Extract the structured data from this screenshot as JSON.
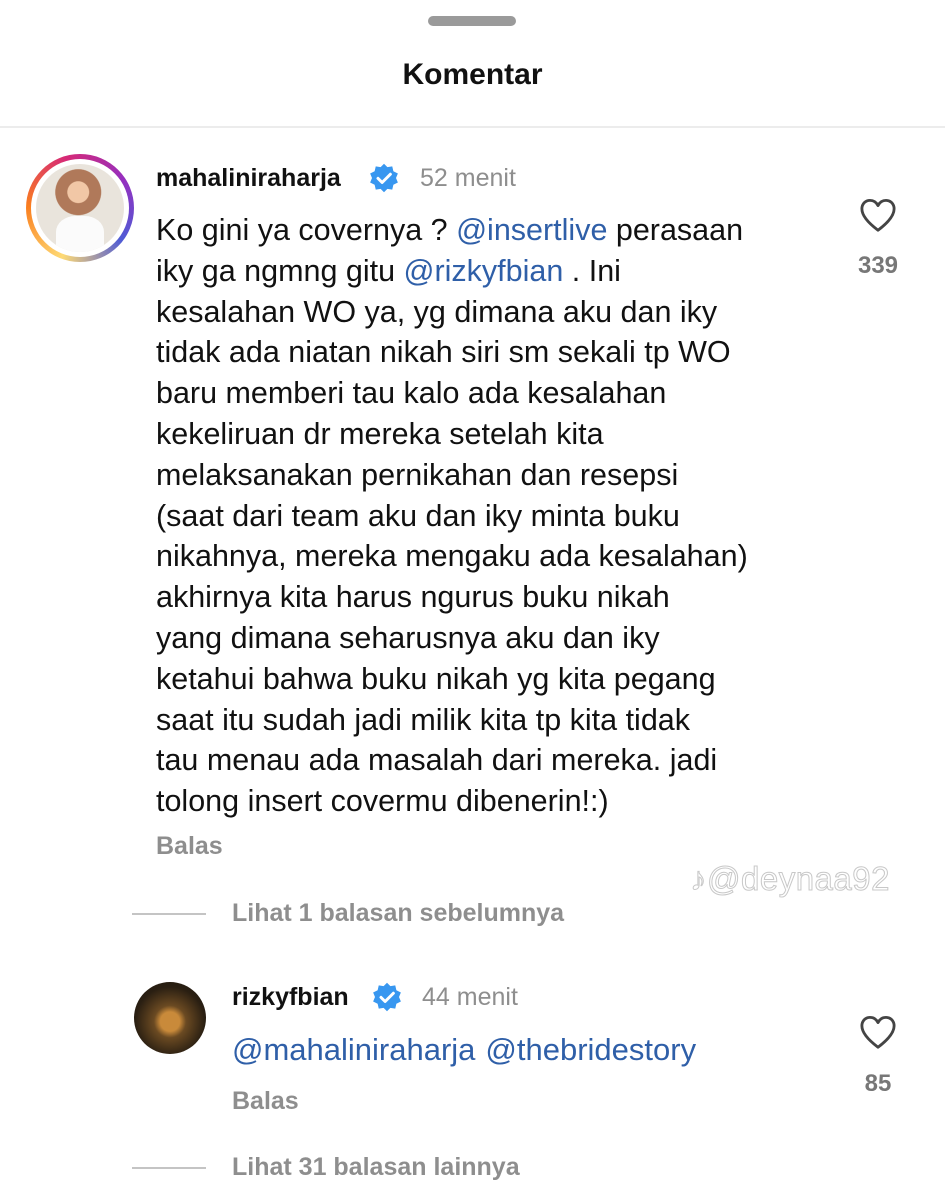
{
  "header": {
    "title": "Komentar"
  },
  "comment": {
    "username": "mahaliniraharja",
    "time": "52 menit",
    "segments": [
      {
        "text": "Ko gini ya covernya ? ",
        "mention": false
      },
      {
        "text": "@insertlive",
        "mention": true
      },
      {
        "text": " perasaan\niky ga ngmng gitu ",
        "mention": false
      },
      {
        "text": "@rizkyfbian",
        "mention": true
      },
      {
        "text": " . Ini\nkesalahan WO ya, yg dimana aku dan iky\ntidak ada niatan nikah siri sm sekali tp WO\nbaru memberi tau kalo ada kesalahan\nkekeliruan dr mereka setelah kita\nmelaksanakan pernikahan dan resepsi\n(saat dari team aku dan iky minta buku\nnikahnya, mereka mengaku ada kesalahan)\nakhirnya kita harus ngurus buku nikah\nyang dimana seharusnya aku dan iky\nketahui bahwa buku nikah yg kita pegang\nsaat itu sudah jadi milik kita tp kita tidak\ntau menau ada masalah dari mereka. jadi\ntolong insert covermu dibenerin!:)",
        "mention": false
      }
    ],
    "reply_label": "Balas",
    "like_count": "339",
    "previous_replies": "Lihat 1 balasan sebelumnya"
  },
  "reply": {
    "username": "rizkyfbian",
    "time": "44 menit",
    "mentions": [
      "@mahaliniraharja",
      "@thebridestory"
    ],
    "reply_label": "Balas",
    "like_count": "85",
    "more_replies": "Lihat 31 balasan lainnya"
  },
  "watermark": "@deynaa92",
  "colors": {
    "mention": "#2f5fa8",
    "verified": "#3897f0",
    "muted": "#8e8e8e"
  },
  "icons": {
    "verified": "verified-badge-icon",
    "like": "heart-outline-icon",
    "watermark": "tiktok-logo-icon"
  }
}
